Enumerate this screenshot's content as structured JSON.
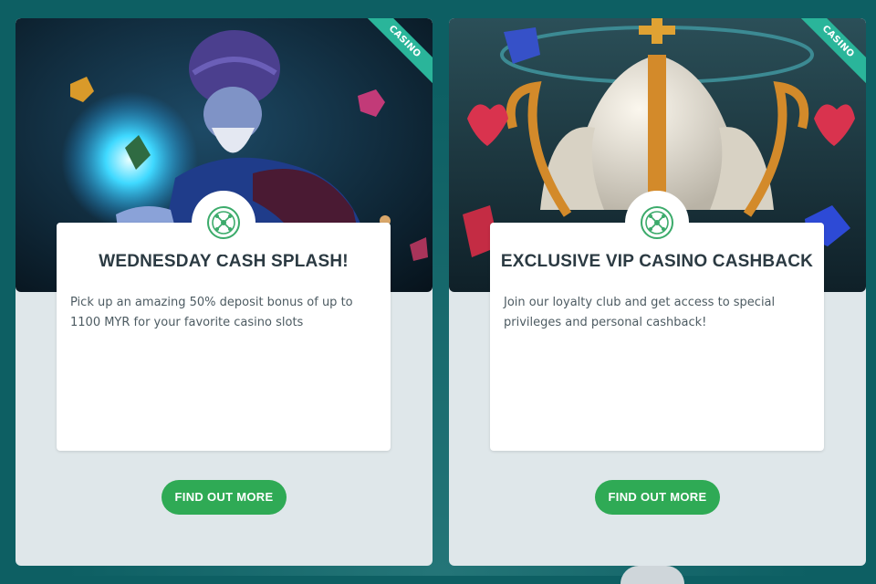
{
  "colors": {
    "page_bg": "#0d5f63",
    "card_bg": "#dfe7ea",
    "ribbon": "#2ab59a",
    "cta": "#2faa55",
    "title_text": "#2b3a42",
    "roulette_icon": "#3cab6b"
  },
  "promotions": [
    {
      "ribbon": "CASINO",
      "icon": "roulette-wheel-icon",
      "title": "WEDNESDAY CASH SPLASH!",
      "description": "Pick up an amazing 50% deposit bonus of up to 1100 MYR for your favorite casino slots",
      "cta": "FIND OUT MORE"
    },
    {
      "ribbon": "CASINO",
      "icon": "roulette-wheel-icon",
      "title": "EXCLUSIVE VIP CASINO CASHBACK",
      "description": "Join our loyalty club and get access to special privileges and personal cashback!",
      "cta": "FIND OUT MORE"
    }
  ]
}
